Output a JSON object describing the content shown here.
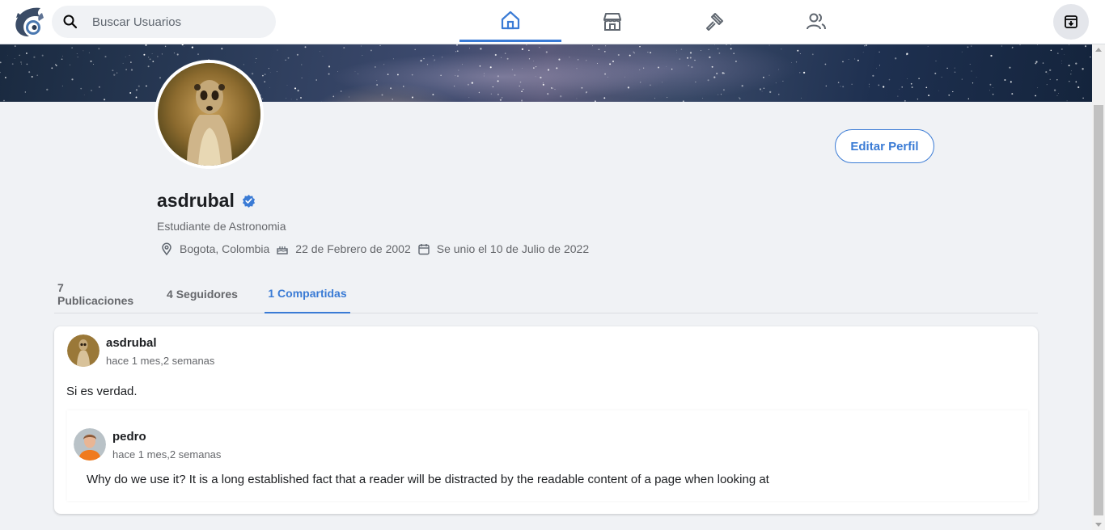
{
  "topbar": {
    "search": {
      "placeholder": "Buscar Usuarios",
      "value": ""
    },
    "nav": [
      {
        "name": "home-icon",
        "active": true
      },
      {
        "name": "store-icon",
        "active": false
      },
      {
        "name": "hammer-icon",
        "active": false
      },
      {
        "name": "users-icon",
        "active": false
      }
    ],
    "accent": "#3a7bd5"
  },
  "profile": {
    "username": "asdrubal",
    "verified": true,
    "bio": "Estudiante de Astronomia",
    "location": "Bogota, Colombia",
    "birthday": "22 de Febrero de 2002",
    "joined": "Se unio el 10 de Julio de 2022",
    "edit_label": "Editar Perfil"
  },
  "tabs": [
    {
      "label": "7 Publicaciones",
      "active": false
    },
    {
      "label": "4 Seguidores",
      "active": false
    },
    {
      "label": "1 Compartidas",
      "active": true
    }
  ],
  "post": {
    "author": "asdrubal",
    "time": "hace 1 mes,2 semanas",
    "text": "Si es verdad.",
    "shared": {
      "author": "pedro",
      "time": "hace 1 mes,2 semanas",
      "text": "Why do we use it? It is a long established fact that a reader will be distracted by the readable content of a page when looking at"
    }
  }
}
